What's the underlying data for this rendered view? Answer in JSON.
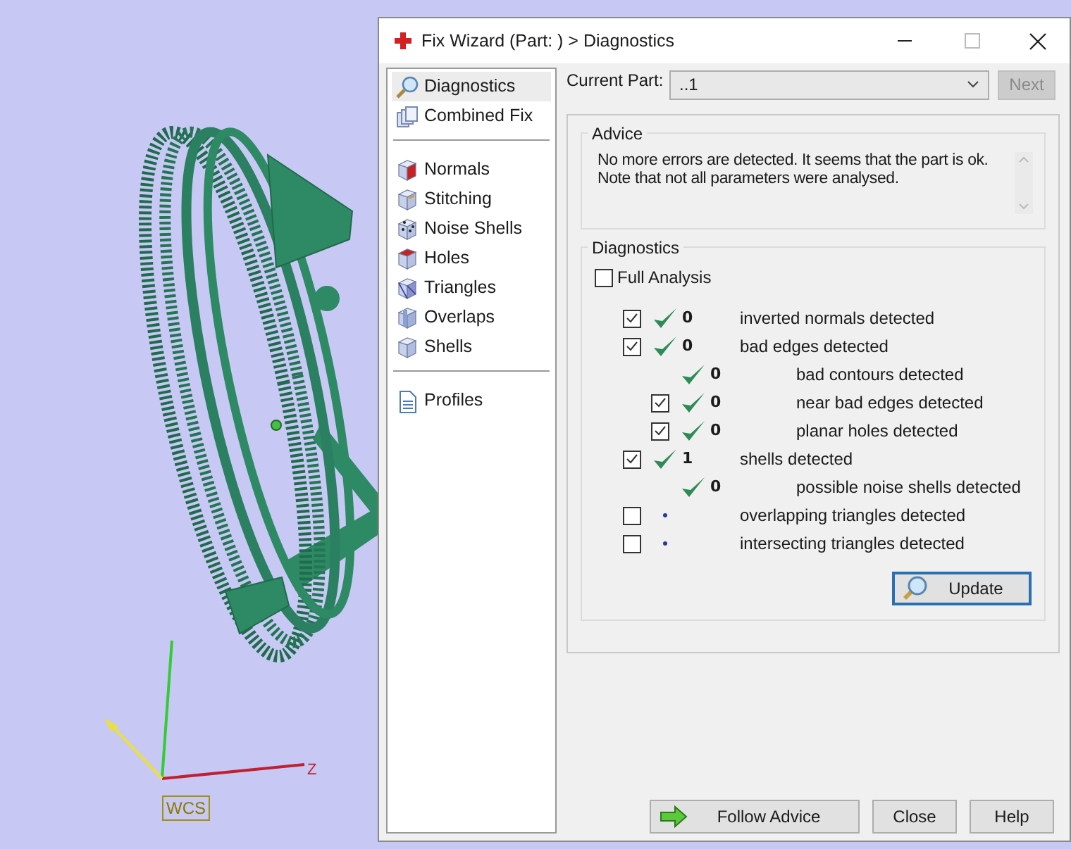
{
  "window": {
    "title": "Fix Wizard (Part: ) > Diagnostics"
  },
  "viewport": {
    "axis_label": "Z",
    "badge": "WCS"
  },
  "nav": {
    "sections": [
      {
        "items": [
          {
            "label": "Diagnostics",
            "selected": true
          },
          {
            "label": "Combined Fix",
            "selected": false
          }
        ]
      },
      {
        "items": [
          {
            "label": "Normals",
            "selected": false
          },
          {
            "label": "Stitching",
            "selected": false
          },
          {
            "label": "Noise Shells",
            "selected": false
          },
          {
            "label": "Holes",
            "selected": false
          },
          {
            "label": "Triangles",
            "selected": false
          },
          {
            "label": "Overlaps",
            "selected": false
          },
          {
            "label": "Shells",
            "selected": false
          }
        ]
      },
      {
        "items": [
          {
            "label": "Profiles",
            "selected": false
          }
        ]
      }
    ]
  },
  "current_part": {
    "label": "Current Part:",
    "value": "..1",
    "next_button": {
      "label": "Next",
      "disabled": true
    }
  },
  "advice": {
    "title": "Advice",
    "text": "No more errors are detected. It seems that the part is ok.\nNote that not all parameters were analysed."
  },
  "diagnostics": {
    "title": "Diagnostics",
    "full_analysis": {
      "label": "Full Analysis",
      "checked": false
    },
    "rows": [
      {
        "kind": "checkbox",
        "checked": true,
        "passed": true,
        "count": "0",
        "label": "inverted normals detected"
      },
      {
        "kind": "checkbox",
        "checked": true,
        "passed": true,
        "count": "0",
        "label": "bad edges detected",
        "children": [
          {
            "kind": "plain",
            "passed": true,
            "count": "0",
            "label": "bad contours detected"
          },
          {
            "kind": "checkbox",
            "checked": true,
            "passed": true,
            "count": "0",
            "label": "near bad edges detected"
          },
          {
            "kind": "checkbox",
            "checked": true,
            "passed": true,
            "count": "0",
            "label": "planar holes detected"
          }
        ]
      },
      {
        "kind": "checkbox",
        "checked": true,
        "passed": true,
        "count": "1",
        "label": "shells detected",
        "children": [
          {
            "kind": "plain",
            "passed": true,
            "count": "0",
            "label": "possible noise shells detected"
          }
        ]
      },
      {
        "kind": "checkbox",
        "checked": false,
        "passed": false,
        "label": "overlapping triangles detected"
      },
      {
        "kind": "checkbox",
        "checked": false,
        "passed": false,
        "label": "intersecting triangles detected"
      }
    ],
    "update_button": "Update"
  },
  "buttons": [
    {
      "kind": "follow",
      "label": "Follow Advice"
    },
    {
      "kind": "plain",
      "label": "Close"
    },
    {
      "kind": "plain",
      "label": "Help"
    }
  ]
}
